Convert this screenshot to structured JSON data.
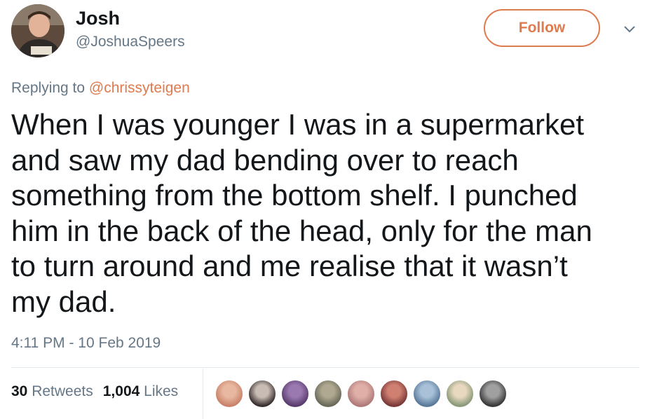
{
  "tweet": {
    "author": {
      "name": "Josh",
      "handle": "@JoshuaSpeers",
      "avatar_icon": "profile-photo"
    },
    "follow_label": "Follow",
    "more_icon": "chevron-down-icon",
    "replying_prefix": "Replying to",
    "replying_to": "@chrissyteigen",
    "text_lines": [
      "When I was younger I was in a supermarket",
      "and saw my dad bending over to reach",
      "something from the bottom shelf. I punched",
      "him in the back of the head, only for the man",
      "to turn around and me realise that it wasn’t",
      "my dad."
    ],
    "timestamp": "4:11 PM - 10 Feb 2019",
    "stats": {
      "retweets_count": "30",
      "retweets_label": "Retweets",
      "likes_count": "1,004",
      "likes_label": "Likes"
    },
    "liker_avatars": [
      {
        "colors": [
          "#c9826b",
          "#e9b8a0"
        ]
      },
      {
        "colors": [
          "#3a3030",
          "#c8bcb4"
        ]
      },
      {
        "colors": [
          "#5a3d6e",
          "#9a78b0"
        ]
      },
      {
        "colors": [
          "#6a6a5a",
          "#b0a890"
        ]
      },
      {
        "colors": [
          "#b07a7a",
          "#e0b0a8"
        ]
      },
      {
        "colors": [
          "#7a3a3a",
          "#d08070"
        ]
      },
      {
        "colors": [
          "#5a7a9a",
          "#a8c0d8"
        ]
      },
      {
        "colors": [
          "#8a9a7a",
          "#e8d8c0"
        ]
      },
      {
        "colors": [
          "#3a3a3a",
          "#a0a0a0"
        ]
      }
    ],
    "colors": {
      "accent": "#e07a4f",
      "secondary_text": "#657786",
      "primary_text": "#14171a",
      "divider": "#e1e8ed"
    }
  }
}
